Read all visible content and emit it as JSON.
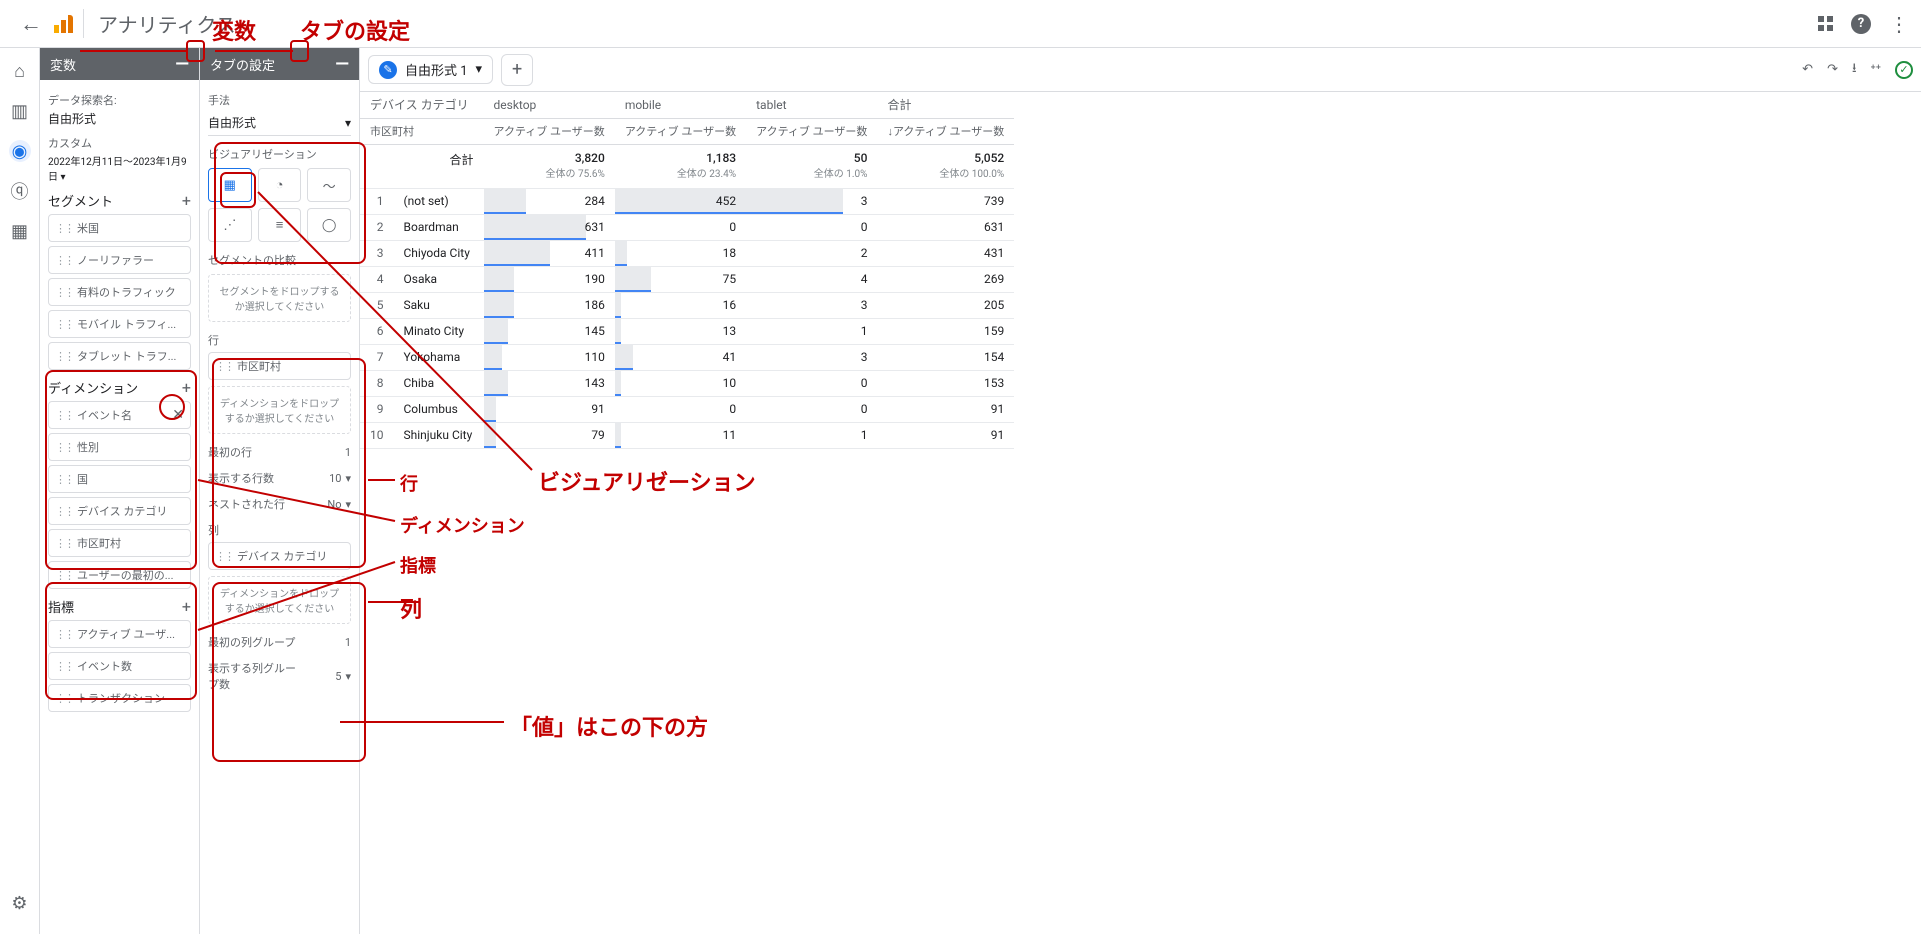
{
  "app_title": "アナリティクス",
  "annotations": {
    "variables": "変数",
    "tab_settings": "タブの設定",
    "rows": "行",
    "dimension": "ディメンション",
    "metrics": "指標",
    "columns": "列",
    "viz": "ビジュアリゼーション",
    "values_below": "「値」はこの下の方"
  },
  "variables_panel": {
    "title": "変数",
    "exploration_name_label": "データ探索名:",
    "exploration_name": "自由形式",
    "date_range_label": "カスタム",
    "date_range": "2022年12月11日～2023年1月9日",
    "segments": {
      "label": "セグメント",
      "items": [
        "米国",
        "ノーリファラー",
        "有料のトラフィック",
        "モバイル トラフィ...",
        "タブレット トラフ..."
      ]
    },
    "dimensions": {
      "label": "ディメンション",
      "items": [
        "イベント名",
        "性別",
        "国",
        "デバイス カテゴリ",
        "市区町村",
        "ユーザーの最初の..."
      ]
    },
    "metrics": {
      "label": "指標",
      "items": [
        "アクティブ ユーザ...",
        "イベント数",
        "トランザクション"
      ]
    }
  },
  "settings_panel": {
    "title": "タブの設定",
    "technique_label": "手法",
    "technique": "自由形式",
    "viz_label": "ビジュアリゼーション",
    "compare_label": "セグメントの比較",
    "compare_drop": "セグメントをドロップするか選択してください",
    "rows": {
      "label": "行",
      "item": "市区町村",
      "drop": "ディメンションをドロップするか選択してください",
      "start_label": "最初の行",
      "start": "1",
      "show_label": "表示する行数",
      "show": "10",
      "nest_label": "ネストされた行",
      "nest": "No"
    },
    "cols": {
      "label": "列",
      "item": "デバイス カテゴリ",
      "drop": "ディメンションをドロップするか選択してください",
      "start_label": "最初の列グループ",
      "start": "1",
      "show_label": "表示する列グループ数",
      "show": "5"
    }
  },
  "tabs": {
    "name": "自由形式 1"
  },
  "table": {
    "h1": {
      "c0": "デバイス カテゴリ",
      "c1": "desktop",
      "c2": "mobile",
      "c3": "tablet",
      "c4": "合計"
    },
    "h2": {
      "c0": "市区町村",
      "c1": "アクティブ ユーザー数",
      "c2": "アクティブ ユーザー数",
      "c3": "アクティブ ユーザー数",
      "c4": "↓アクティブ ユーザー数"
    },
    "total": {
      "label": "合計",
      "v1": "3,820",
      "s1": "全体の 75.6%",
      "v2": "1,183",
      "s2": "全体の 23.4%",
      "v3": "50",
      "s3": "全体の 1.0%",
      "v4": "5,052",
      "s4": "全体の 100.0%"
    },
    "rows": [
      {
        "n": "1",
        "city": "(not set)",
        "v1": "284",
        "b1": 7,
        "v2": "452",
        "b2": 38,
        "v3": "3",
        "v4": "739"
      },
      {
        "n": "2",
        "city": "Boardman",
        "v1": "631",
        "b1": 17,
        "v2": "0",
        "b2": 0,
        "v3": "0",
        "v4": "631"
      },
      {
        "n": "3",
        "city": "Chiyoda City",
        "v1": "411",
        "b1": 11,
        "v2": "18",
        "b2": 2,
        "v3": "2",
        "v4": "431"
      },
      {
        "n": "4",
        "city": "Osaka",
        "v1": "190",
        "b1": 5,
        "v2": "75",
        "b2": 6,
        "v3": "4",
        "v4": "269"
      },
      {
        "n": "5",
        "city": "Saku",
        "v1": "186",
        "b1": 5,
        "v2": "16",
        "b2": 1,
        "v3": "3",
        "v4": "205"
      },
      {
        "n": "6",
        "city": "Minato City",
        "v1": "145",
        "b1": 4,
        "v2": "13",
        "b2": 1,
        "v3": "1",
        "v4": "159"
      },
      {
        "n": "7",
        "city": "Yokohama",
        "v1": "110",
        "b1": 3,
        "v2": "41",
        "b2": 3,
        "v3": "3",
        "v4": "154"
      },
      {
        "n": "8",
        "city": "Chiba",
        "v1": "143",
        "b1": 4,
        "v2": "10",
        "b2": 1,
        "v3": "0",
        "v4": "153"
      },
      {
        "n": "9",
        "city": "Columbus",
        "v1": "91",
        "b1": 2,
        "v2": "0",
        "b2": 0,
        "v3": "0",
        "v4": "91"
      },
      {
        "n": "10",
        "city": "Shinjuku City",
        "v1": "79",
        "b1": 2,
        "v2": "11",
        "b2": 1,
        "v3": "1",
        "v4": "91"
      }
    ]
  }
}
